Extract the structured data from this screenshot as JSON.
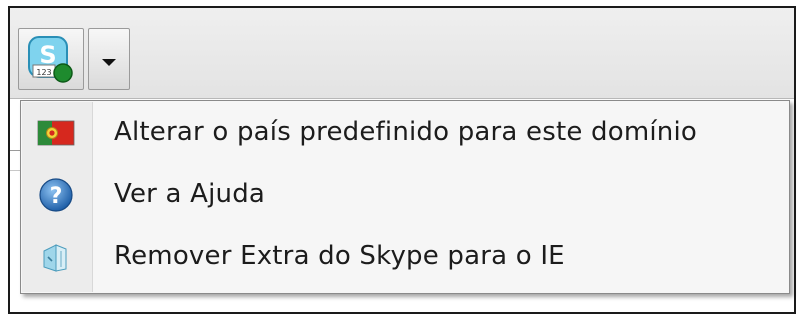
{
  "menu": {
    "items": [
      {
        "label": "Alterar o país predefinido para este domínio",
        "icon": "portugal-flag-icon"
      },
      {
        "label": "Ver a Ajuda",
        "icon": "help-icon"
      },
      {
        "label": "Remover Extra do Skype para o IE",
        "icon": "remove-addon-icon"
      }
    ]
  },
  "toolbar": {
    "skype_button_icon": "skype-status-icon",
    "dropdown_icon": "dropdown-arrow-icon"
  },
  "colors": {
    "menu_background": "#f6f6f6",
    "menu_gutter": "#ececec",
    "help_blue": "#2f6fb6",
    "flag_green": "#2d8a3a",
    "flag_red": "#d6281e"
  }
}
